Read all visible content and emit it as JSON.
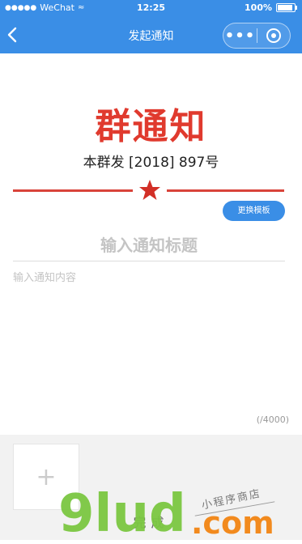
{
  "status": {
    "carrier": "WeChat",
    "signal": "●●●●●",
    "time": "12:25",
    "battery": "100%",
    "battery_level": 1.0
  },
  "nav": {
    "title": "发起通知"
  },
  "doc": {
    "headline": "群通知",
    "number": "本群发 [2018] 897号"
  },
  "template_button": "更换模板",
  "title_input": {
    "placeholder": "输入通知标题",
    "value": ""
  },
  "content_input": {
    "placeholder": "输入通知内容",
    "value": ""
  },
  "counter": "(/4000)",
  "upload_plus": "+",
  "done_label": "完成",
  "watermark": {
    "brand": "9lud",
    "tld": ".com",
    "tagline": "小程序商店"
  },
  "colors": {
    "nav_blue": "#3a8ee6",
    "headline_red": "#e03a2e",
    "watermark_green": "#7bc742"
  },
  "icons": {
    "back": "chevron-left-icon",
    "more": "more-dots-icon",
    "close": "record-ring-icon",
    "star": "star-icon",
    "wifi": "wifi-icon"
  }
}
